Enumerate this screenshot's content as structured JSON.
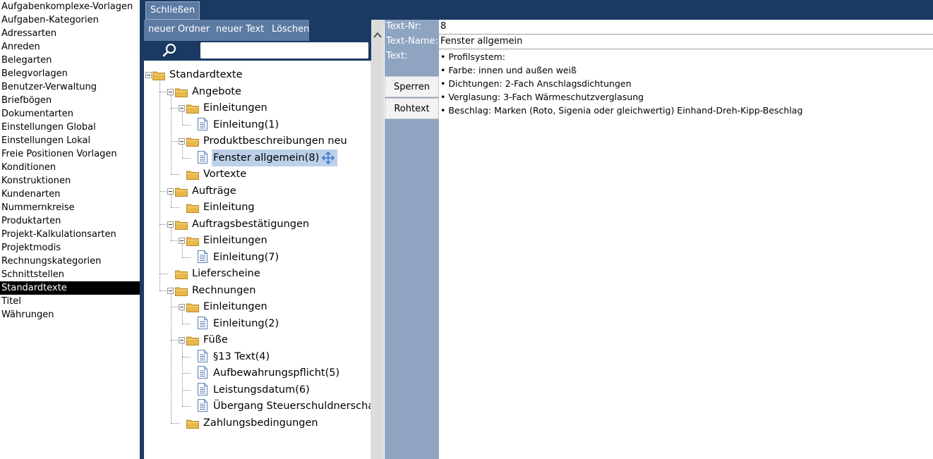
{
  "categories": {
    "items": [
      "Aufgabenkomplexe-Vorlagen",
      "Aufgaben-Kategorien",
      "Adressarten",
      "Anreden",
      "Belegarten",
      "Belegvorlagen",
      "Benutzer-Verwaltung",
      "Briefbögen",
      "Dokumentarten",
      "Einstellungen Global",
      "Einstellungen Lokal",
      "Freie Positionen Vorlagen",
      "Konditionen",
      "Konstruktionen",
      "Kundenarten",
      "Nummernkreise",
      "Produktarten",
      "Projekt-Kalkulationsarten",
      "Projektmodis",
      "Rechnungskategorien",
      "Schnittstellen",
      "Standardtexte",
      "Titel",
      "Währungen"
    ],
    "selected": "Standardtexte"
  },
  "topbar": {
    "close_label": "Schließen"
  },
  "toolbar": {
    "new_folder_label": "neuer Ordner",
    "new_text_label": "neuer Text",
    "delete_label": "Löschen",
    "search_icon": "magnifier-icon",
    "search_value": ""
  },
  "tree": {
    "nodes": [
      {
        "label": "Standardtexte",
        "kind": "folder",
        "level": 0,
        "expanded": true
      },
      {
        "label": "Angebote",
        "kind": "folder",
        "level": 1,
        "expanded": true
      },
      {
        "label": "Einleitungen",
        "kind": "folder",
        "level": 2,
        "expanded": true
      },
      {
        "label": "Einleitung(1)",
        "kind": "text",
        "level": 3
      },
      {
        "label": "Produktbeschreibungen neu",
        "kind": "folder",
        "level": 2,
        "expanded": true
      },
      {
        "label": "Fenster allgemein(8)",
        "kind": "text",
        "level": 3,
        "selected": true
      },
      {
        "label": "Vortexte",
        "kind": "folder",
        "level": 2
      },
      {
        "label": "Aufträge",
        "kind": "folder",
        "level": 1,
        "expanded": true
      },
      {
        "label": "Einleitung",
        "kind": "folder",
        "level": 2
      },
      {
        "label": "Auftragsbestätigungen",
        "kind": "folder",
        "level": 1,
        "expanded": true
      },
      {
        "label": "Einleitungen",
        "kind": "folder",
        "level": 2,
        "expanded": true
      },
      {
        "label": "Einleitung(7)",
        "kind": "text",
        "level": 3
      },
      {
        "label": "Lieferscheine",
        "kind": "folder",
        "level": 1
      },
      {
        "label": "Rechnungen",
        "kind": "folder",
        "level": 1,
        "expanded": true
      },
      {
        "label": "Einleitungen",
        "kind": "folder",
        "level": 2,
        "expanded": true
      },
      {
        "label": "Einleitung(2)",
        "kind": "text",
        "level": 3
      },
      {
        "label": "Füße",
        "kind": "folder",
        "level": 2,
        "expanded": true
      },
      {
        "label": "§13 Text(4)",
        "kind": "text",
        "level": 3
      },
      {
        "label": "Aufbewahrungspflicht(5)",
        "kind": "text",
        "level": 3
      },
      {
        "label": "Leistungsdatum(6)",
        "kind": "text",
        "level": 3
      },
      {
        "label": "Übergang Steuerschuldnerschaft(",
        "kind": "text",
        "level": 3
      },
      {
        "label": "Zahlungsbedingungen",
        "kind": "folder",
        "level": 2
      }
    ]
  },
  "detail": {
    "nr_label": "Text-Nr:",
    "nr_value": "8",
    "name_label": "Text-Name:",
    "name_value": "Fenster allgemein",
    "text_label": "Text:",
    "lock_label": "Sperren",
    "raw_label": "Rohtext",
    "text_lines": [
      "• Profilsystem:",
      "• Farbe: innen und außen weiß",
      "• Dichtungen: 2-Fach Anschlagsdichtungen",
      "• Verglasung: 3-Fach Wärmeschutzverglasung",
      "• Beschlag: Marken (Roto, Sigenia oder gleichwertig) Einhand-Dreh-Kipp-Beschlag"
    ]
  },
  "colors": {
    "navy": "#1b3a63",
    "button_blue": "#5d7aa3",
    "label_column": "#8ea4c1",
    "selection": "#bcd0ea",
    "folder": "#e8b84a"
  }
}
